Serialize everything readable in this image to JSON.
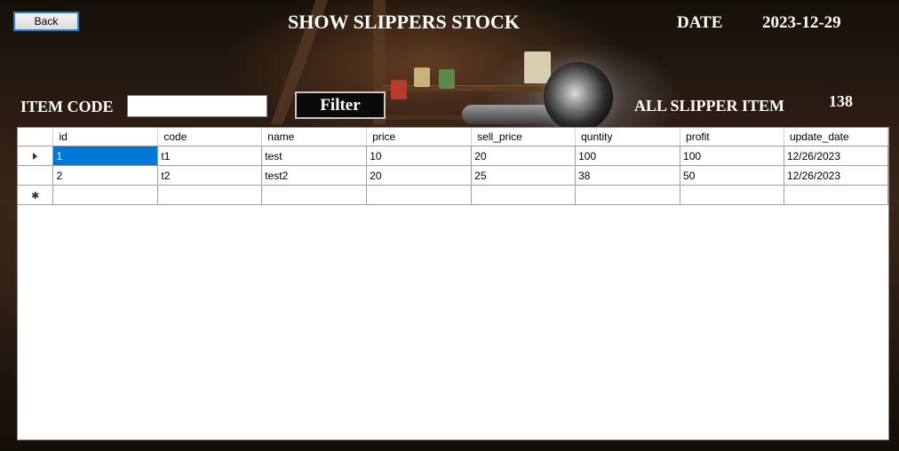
{
  "header": {
    "back_label": "Back",
    "title": "SHOW SLIPPERS STOCK",
    "date_label": "DATE",
    "date_value": "2023-12-29"
  },
  "filter": {
    "item_code_label": "ITEM CODE",
    "item_code_value": "",
    "filter_label": "Filter",
    "all_label": "ALL SLIPPER ITEM",
    "all_count": "138"
  },
  "grid": {
    "columns": [
      "id",
      "code",
      "name",
      "price",
      "sell_price",
      "quntity",
      "profit",
      "update_date"
    ],
    "rows": [
      [
        "1",
        "t1",
        "test",
        "10",
        "20",
        "100",
        "100",
        "12/26/2023"
      ],
      [
        "2",
        "t2",
        "test2",
        "20",
        "25",
        "38",
        "50",
        "12/26/2023"
      ]
    ],
    "current_row_icon": "current-row-arrow-icon",
    "new_row_icon": "new-row-asterisk-icon"
  },
  "colors": {
    "selection": "#0078d7",
    "back_border": "#2a7bd4"
  }
}
